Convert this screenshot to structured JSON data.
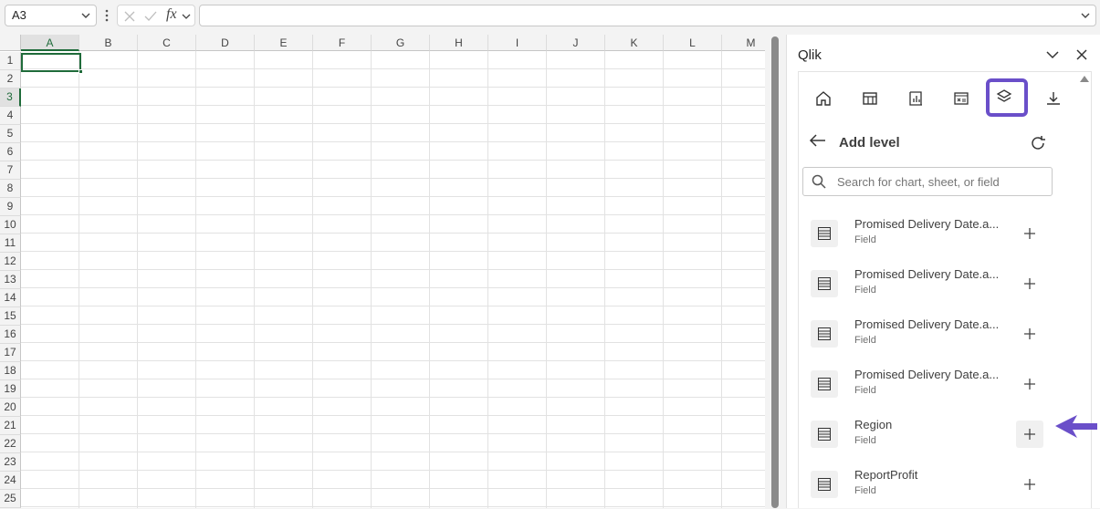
{
  "formula_bar": {
    "name_box": "A3",
    "formula": ""
  },
  "sheet": {
    "columns": [
      "A",
      "B",
      "C",
      "D",
      "E",
      "F",
      "G",
      "H",
      "I",
      "J",
      "K",
      "L",
      "M"
    ],
    "rows": [
      "1",
      "2",
      "3",
      "4",
      "5",
      "6",
      "7",
      "8",
      "9",
      "10",
      "11",
      "12",
      "13",
      "14",
      "15",
      "16",
      "17",
      "18",
      "19",
      "20",
      "21",
      "22",
      "23",
      "24",
      "25"
    ],
    "active_cell": "A3"
  },
  "pane": {
    "title": "Qlik",
    "tabs": [
      {
        "icon": "home-icon"
      },
      {
        "icon": "table-icon"
      },
      {
        "icon": "chart-icon"
      },
      {
        "icon": "variable-icon"
      },
      {
        "icon": "layers-icon",
        "active": true
      },
      {
        "icon": "download-icon"
      }
    ],
    "view_title": "Add level",
    "search_placeholder": "Search for chart, sheet, or field",
    "items": [
      {
        "name": "Promised Delivery Date.a...",
        "type": "Field"
      },
      {
        "name": "Promised Delivery Date.a...",
        "type": "Field"
      },
      {
        "name": "Promised Delivery Date.a...",
        "type": "Field"
      },
      {
        "name": "Promised Delivery Date.a...",
        "type": "Field"
      },
      {
        "name": "Region",
        "type": "Field"
      },
      {
        "name": "ReportProfit",
        "type": "Field"
      }
    ],
    "accent_color": "#6a4fc9"
  }
}
